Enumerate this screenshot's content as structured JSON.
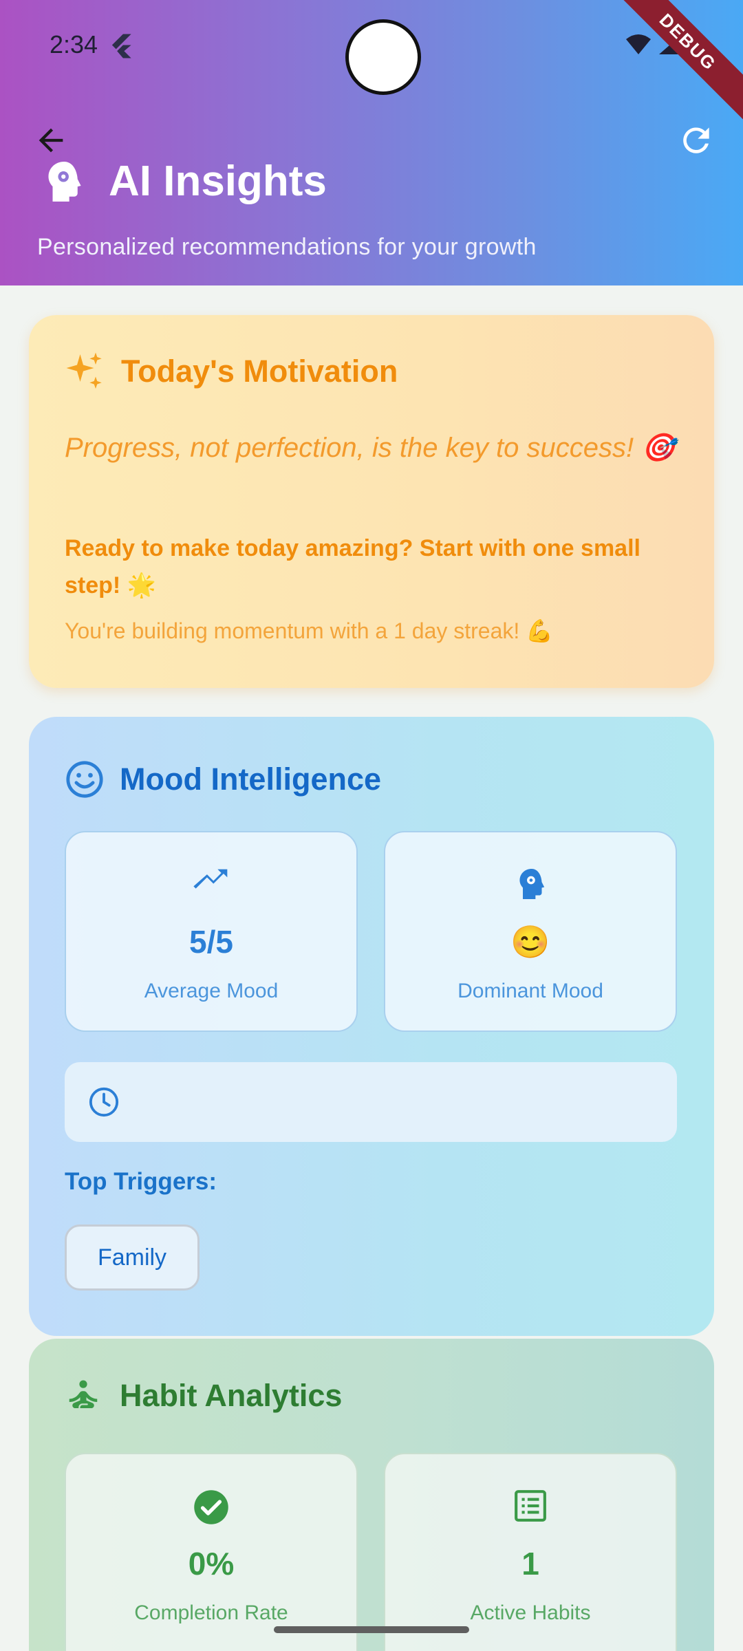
{
  "status_bar": {
    "time": "2:34",
    "debug_label": "DEBUG"
  },
  "header": {
    "title": "AI Insights",
    "subtitle": "Personalized recommendations for your growth",
    "icons": [
      "arrow-back-icon",
      "refresh-icon",
      "psychology-icon"
    ]
  },
  "motivation": {
    "title": "Today's Motivation",
    "quote": "Progress, not perfection, is the key to success! 🎯",
    "call_to_action": "Ready to make today amazing? Start with one small step! 🌟",
    "streak_text": "You're building momentum with a 1 day streak! 💪"
  },
  "mood": {
    "title": "Mood Intelligence",
    "stats": [
      {
        "value": "5/5",
        "label": "Average Mood",
        "icon": "trending-up-icon"
      },
      {
        "value": "😊",
        "label": "Dominant Mood",
        "icon": "psychology-icon"
      }
    ],
    "top_triggers_label": "Top Triggers:",
    "triggers": [
      "Family"
    ]
  },
  "habits": {
    "title": "Habit Analytics",
    "stats": [
      {
        "value": "0%",
        "label": "Completion Rate",
        "icon": "check-circle-icon"
      },
      {
        "value": "1",
        "label": "Active Habits",
        "icon": "list-icon"
      }
    ]
  },
  "colors": {
    "header_gradient_start": "#ab52c3",
    "header_gradient_end": "#4aa9f5",
    "motivation_accent": "#f08c0c",
    "mood_accent": "#1468c7",
    "habit_accent": "#2e7d32"
  }
}
